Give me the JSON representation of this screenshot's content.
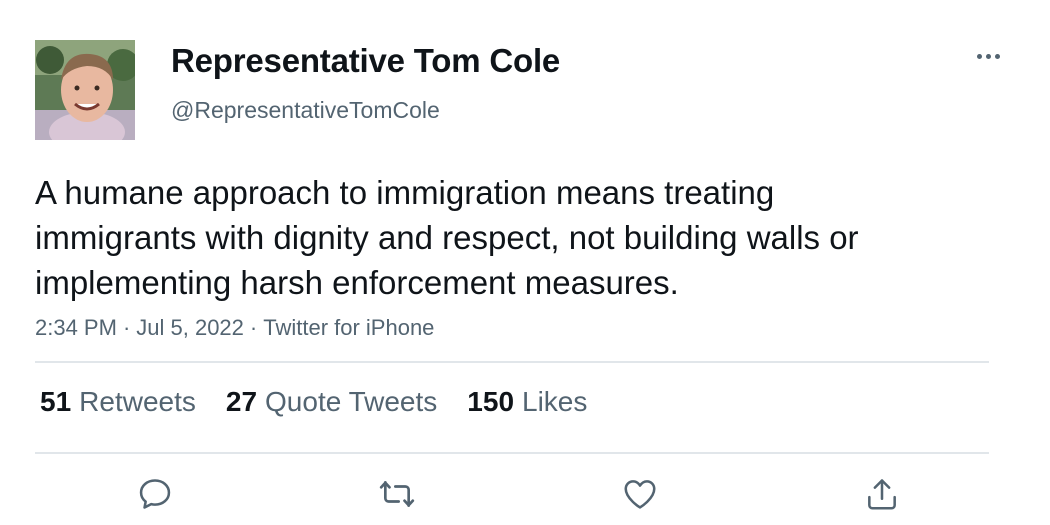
{
  "author": {
    "display_name": "Representative Tom Cole",
    "handle": "@RepresentativeTomCole"
  },
  "tweet": {
    "text": "A humane approach to immigration means treating immigrants with dignity and respect, not building walls or implementing harsh enforcement measures.",
    "time": "2:34 PM",
    "date": "Jul 5, 2022",
    "source": "Twitter for iPhone",
    "separator": "·"
  },
  "stats": {
    "retweets": {
      "count": "51",
      "label": "Retweets"
    },
    "quote_tweets": {
      "count": "27",
      "label": "Quote Tweets"
    },
    "likes": {
      "count": "150",
      "label": "Likes"
    }
  },
  "actions": {
    "icons": [
      "reply-icon",
      "retweet-icon",
      "like-icon",
      "share-icon"
    ]
  },
  "colors": {
    "text_primary": "#0f1419",
    "text_secondary": "#536471",
    "divider": "#e1e6ea"
  }
}
